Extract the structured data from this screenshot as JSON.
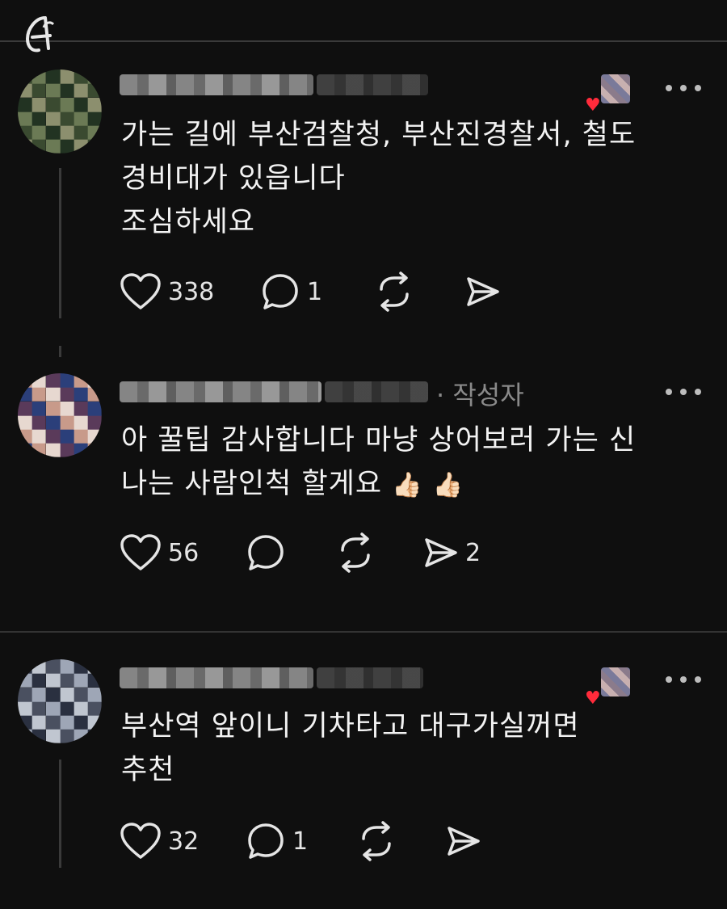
{
  "posts": [
    {
      "text": "가는 길에 부산검찰청, 부산진경찰서, 철도\n경비대가 있읍니다\n조심하세요",
      "stats": {
        "likes": "338",
        "replies": "1",
        "reposts": "",
        "shares": ""
      },
      "author_tag": "",
      "avatar_palette": [
        "#3a4a30",
        "#6b7a55",
        "#223322",
        "#8c8f6e"
      ]
    },
    {
      "text": "아 꿀팁 감사합니다 마냥 상어보러 가는 신\n나는 사람인척 할게요",
      "emojis": [
        "👍🏻",
        "👍🏻"
      ],
      "stats": {
        "likes": "56",
        "replies": "",
        "reposts": "",
        "shares": "2"
      },
      "author_tag": "· 작성자",
      "avatar_palette": [
        "#2b3f7a",
        "#c89a8a",
        "#e7d8d0",
        "#5a3a5a"
      ]
    },
    {
      "text": "부산역 앞이니 기차타고 대구가실꺼면\n추천",
      "stats": {
        "likes": "32",
        "replies": "1",
        "reposts": "",
        "shares": ""
      },
      "author_tag": "",
      "avatar_palette": [
        "#4a5060",
        "#9ea6b6",
        "#2a3040",
        "#c0c6d0"
      ]
    }
  ],
  "icons": {
    "like": "heart-outline-icon",
    "reply": "comment-bubble-icon",
    "repost": "repost-arrows-icon",
    "share": "send-arrow-icon",
    "more": "more-dots-icon"
  },
  "colors": {
    "background": "#0f0f0f",
    "text": "#f3f3f3",
    "muted": "#8a8a8a",
    "heart_badge": "#ff2b3b"
  }
}
